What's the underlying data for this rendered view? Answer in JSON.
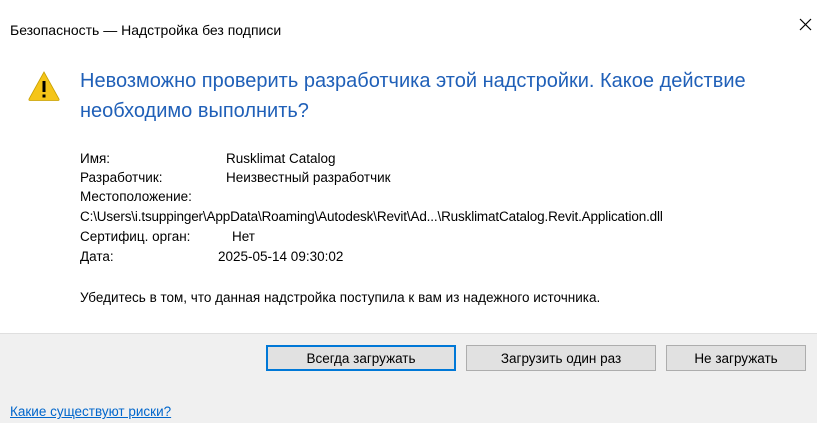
{
  "window": {
    "title": "Безопасность — Надстройка без подписи",
    "close_icon": "close-icon"
  },
  "colors": {
    "headline": "#2060b8",
    "link": "#0066cc",
    "warning_fill": "#f5c518",
    "default_button_border": "#0078d7",
    "button_bar_bg": "#f0f0f0"
  },
  "message": {
    "icon": "warning-icon",
    "headline": "Невозможно проверить разработчика этой надстройки. Какое действие необходимо выполнить?"
  },
  "details": {
    "name_label": "Имя:",
    "name_value": "Rusklimat Catalog",
    "developer_label": "Разработчик:",
    "developer_value": "Неизвестный разработчик",
    "location_label": "Местоположение:",
    "location_value": "C:\\Users\\i.tsuppinger\\AppData\\Roaming\\Autodesk\\Revit\\Ad...\\RusklimatCatalog.Revit.Application.dll",
    "cert_label": "Сертифиц. орган:",
    "cert_value": "Нет",
    "date_label": "Дата:",
    "date_value": "2025-05-14 09:30:02"
  },
  "trust_note": "Убедитесь в том, что данная надстройка поступила к вам из надежного источника.",
  "buttons": {
    "always_load": "Всегда загружать",
    "load_once": "Загрузить один раз",
    "do_not_load": "Не загружать"
  },
  "footer": {
    "risks_link": "Какие существуют риски?"
  }
}
